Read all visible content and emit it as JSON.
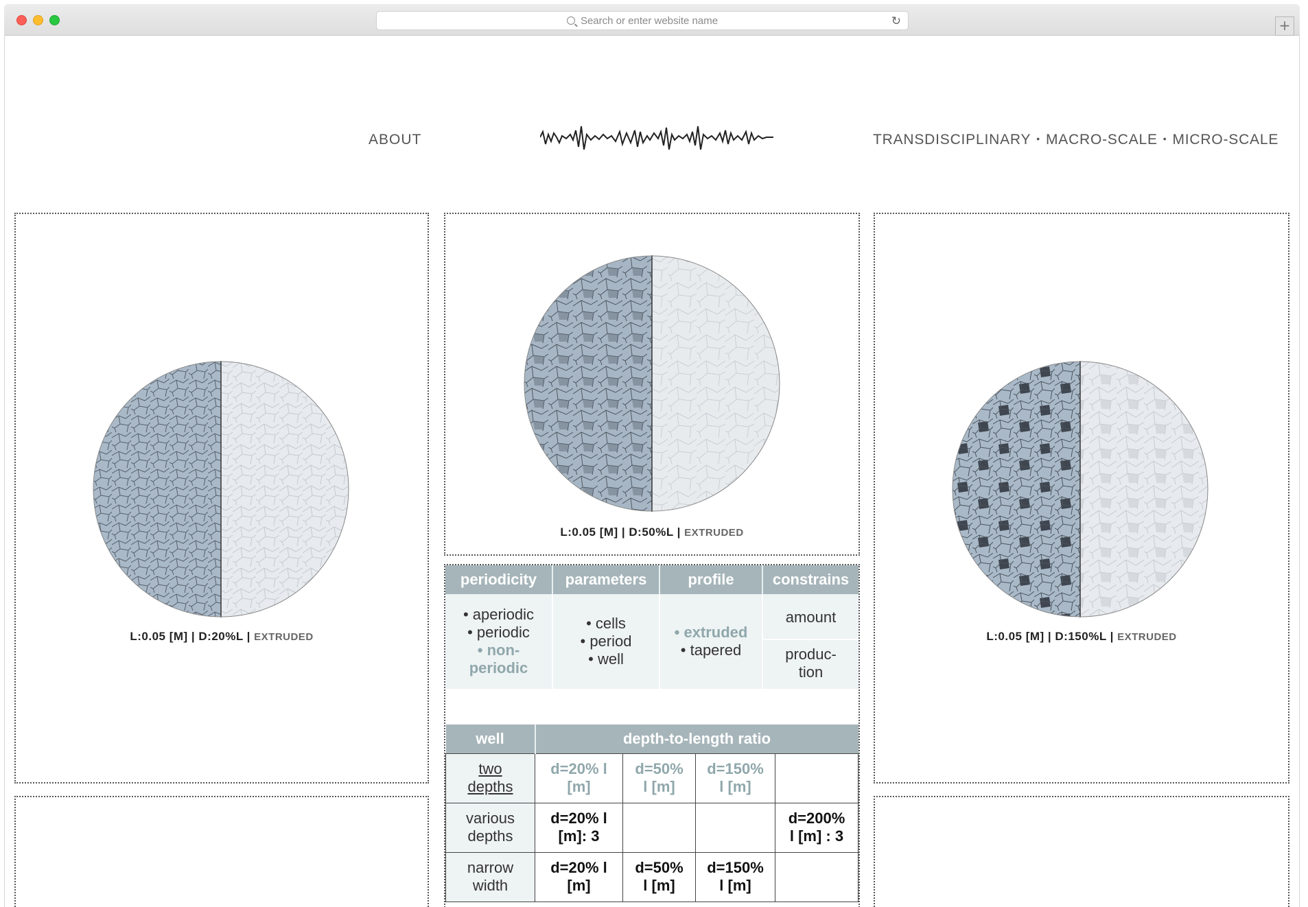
{
  "browser": {
    "address_placeholder": "Search or enter website name",
    "new_tab_label": "+"
  },
  "nav": {
    "about": "ABOUT",
    "items": [
      "TRANSDISCIPLINARY",
      "MACRO-SCALE",
      "MICRO-SCALE"
    ],
    "separator": "•",
    "logo_icon": "waveform-logo-icon"
  },
  "panels": {
    "left": {
      "caption_main": "L:0.05 [M] | D:20%L | ",
      "caption_ext": "EXTRUDED"
    },
    "center": {
      "caption_main": "L:0.05 [M] | D:50%L | ",
      "caption_ext": "EXTRUDED"
    },
    "right": {
      "caption_main": "L:0.05 [M] | D:150%L | ",
      "caption_ext": "EXTRUDED"
    }
  },
  "table1": {
    "headers": [
      "periodicity",
      "parameters",
      "profile",
      "constrains"
    ],
    "periodicity": [
      "• aperiodic",
      "• periodic",
      "• non-",
      "periodic"
    ],
    "parameters": [
      "• cells",
      "• period",
      "• well"
    ],
    "profile": [
      "• extruded",
      "• tapered"
    ],
    "constrains": [
      "amount",
      "produc-",
      "tion"
    ]
  },
  "table2": {
    "headers": [
      "well",
      "depth-to-length ratio"
    ],
    "rows": [
      {
        "label": [
          "two",
          "depths"
        ],
        "cells": [
          [
            "d=20% l",
            "[m]"
          ],
          [
            "d=50%",
            "l [m]"
          ],
          [
            "d=150%",
            "l [m]"
          ],
          [
            "",
            ""
          ]
        ]
      },
      {
        "label": [
          "various",
          "depths"
        ],
        "cells": [
          [
            "d=20% l",
            "[m]: 3"
          ],
          [
            "",
            ""
          ],
          [
            "",
            ""
          ],
          [
            "d=200%",
            "l [m] : 3"
          ]
        ]
      },
      {
        "label": [
          "narrow",
          "width"
        ],
        "cells": [
          [
            "d=20% l",
            "[m]"
          ],
          [
            "d=50%",
            "l [m]"
          ],
          [
            "d=150%",
            "l [m]"
          ],
          [
            "",
            ""
          ]
        ]
      }
    ]
  },
  "colors": {
    "accent": "#8fa7ab",
    "table_header": "#a6b5b9",
    "sphere_left": "#a9b9c8",
    "sphere_right": "#e7eaee"
  }
}
